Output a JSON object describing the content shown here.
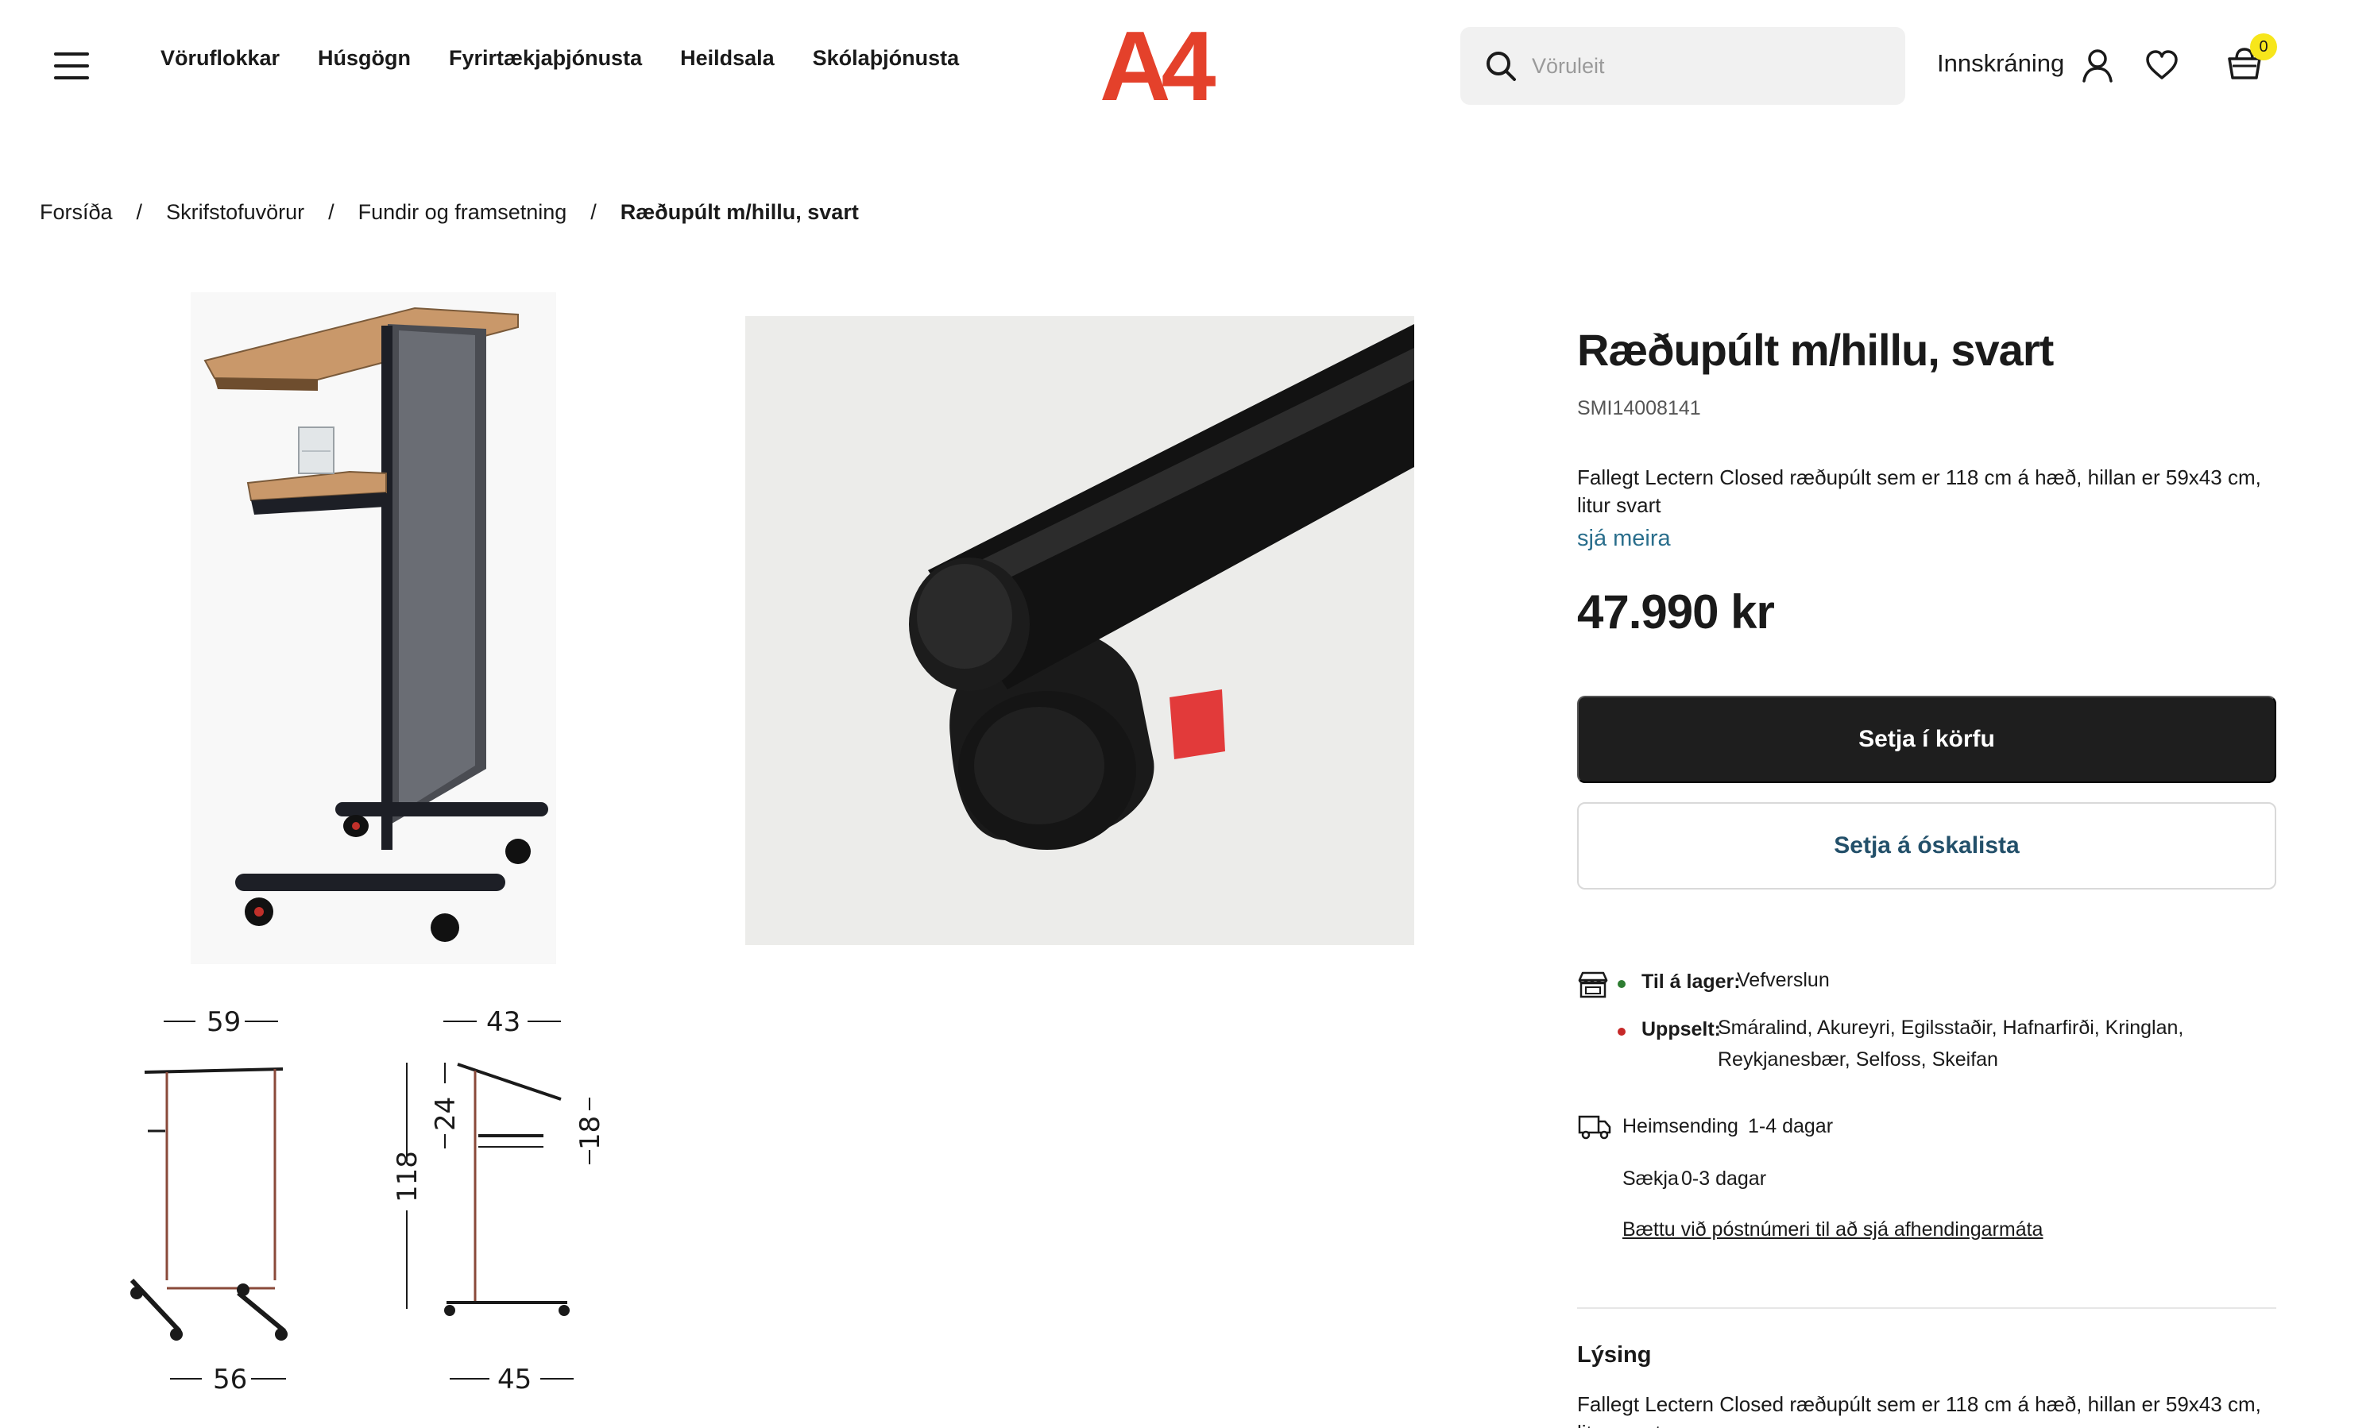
{
  "header": {
    "nav": [
      "Vöruflokkar",
      "Húsgögn",
      "Fyrirtækjaþjónusta",
      "Heildsala",
      "Skólaþjónusta"
    ],
    "logo_text": "A4",
    "search_placeholder": "Vöruleit",
    "login_label": "Innskráning",
    "cart_count": "0"
  },
  "breadcrumb": {
    "items": [
      "Forsíða",
      "Skrifstofuvörur",
      "Fundir og framsetning"
    ],
    "current": "Ræðupúlt m/hillu, svart",
    "separator": "/"
  },
  "gallery": {
    "dimensions": {
      "front_width_top": "59",
      "front_width_bottom": "56",
      "side_depth_top": "43",
      "side_depth_bottom": "45",
      "height": "118",
      "upper_section": "24",
      "slope": "18"
    }
  },
  "product": {
    "title": "Ræðupúlt m/hillu, svart",
    "sku": "SMI14008141",
    "short_description": "Fallegt Lectern Closed ræðupúlt sem er 118 cm á hæð, hillan er 59x43 cm, litur svart",
    "see_more": "sjá meira",
    "price": "47.990 kr",
    "add_to_cart": "Setja í körfu",
    "add_to_wishlist": "Setja á óskalista"
  },
  "stock": {
    "in_stock_label": "Til á lager:",
    "in_stock_value": "Vefverslun",
    "sold_out_label": "Uppselt:",
    "sold_out_value": "Smáralind, Akureyri, Egilsstaðir, Hafnarfirði, Kringlan, Reykjanesbær, Selfoss, Skeifan"
  },
  "shipping": {
    "home_label": "Heimsending",
    "home_value": "1-4 dagar",
    "pickup_label": "Sækja",
    "pickup_value": "0-3 dagar",
    "postal_link": "Bættu við póstnúmeri til að sjá afhendingarmáta"
  },
  "description": {
    "heading": "Lýsing",
    "text": "Fallegt Lectern Closed ræðupúlt sem er 118 cm á hæð, hillan er 59x43 cm, litur svart"
  },
  "colors": {
    "logo": "#e4412b",
    "primary_button": "#1e1e1e",
    "link": "#2a6e8c",
    "in_stock_dot": "#2e7d32",
    "sold_out_dot": "#c62828",
    "cart_badge": "#f7e61b"
  }
}
